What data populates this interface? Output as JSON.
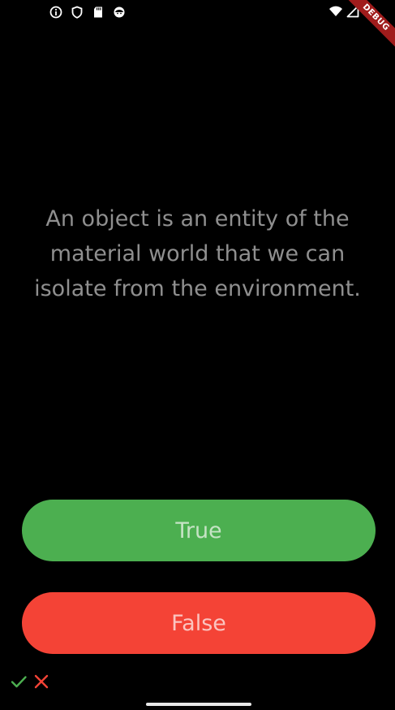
{
  "status_bar": {
    "left_icons": [
      "info-icon",
      "shield-icon",
      "sd-card-icon",
      "face-icon"
    ],
    "right_icons": [
      "wifi-icon",
      "signal-icon"
    ]
  },
  "debug_banner": {
    "label": "DEBUG"
  },
  "quiz": {
    "question": "An object is an entity of the material world that we can isolate from the environment.",
    "true_label": "True",
    "false_label": "False",
    "true_color": "#4caf50",
    "false_color": "#f44336"
  },
  "score": {
    "marks": [
      "check-icon",
      "cross-icon"
    ],
    "check_color": "#4caf50",
    "cross_color": "#f44336"
  }
}
